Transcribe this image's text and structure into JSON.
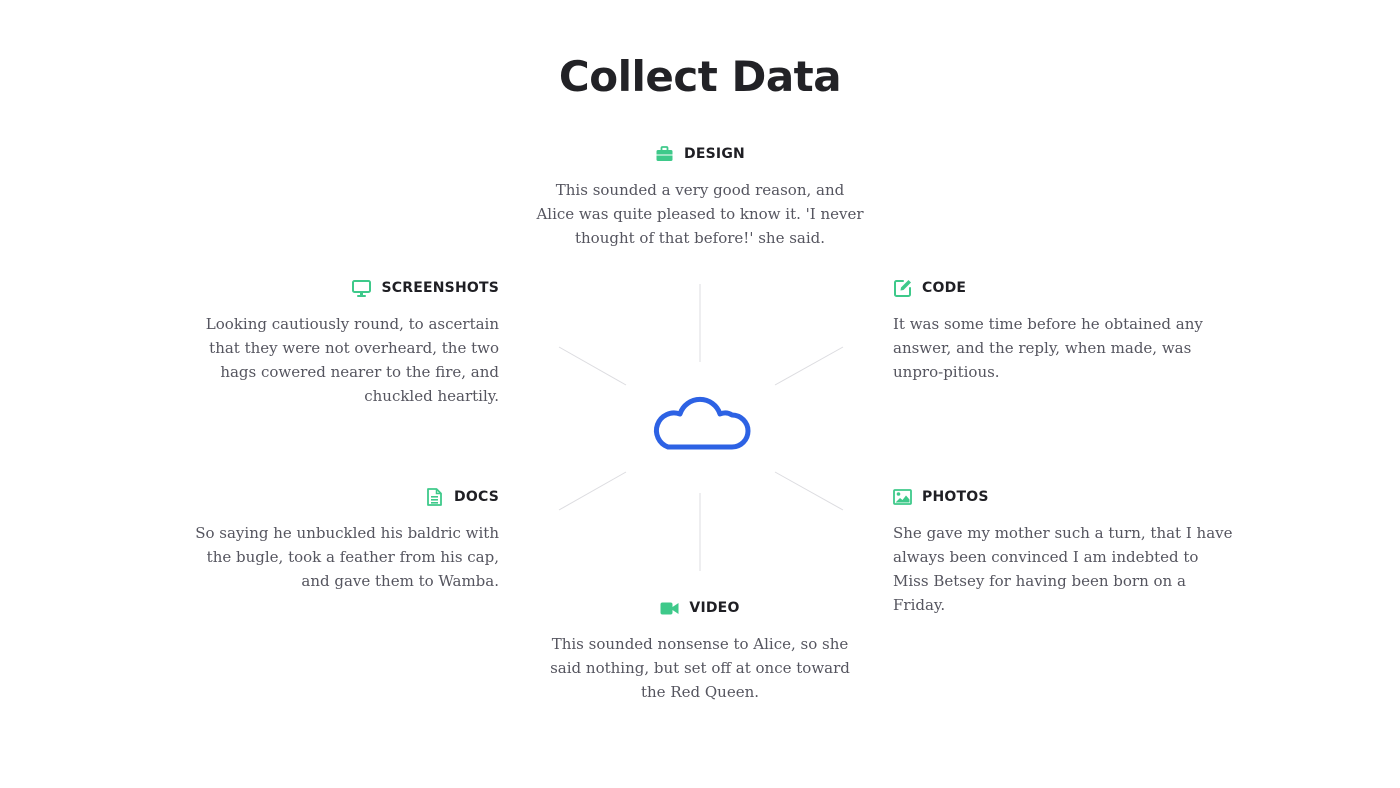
{
  "title": "Collect Data",
  "accent_color": "#3ec98a",
  "cloud_color": "#2d62e4",
  "center_icon": "cloud-icon",
  "features": {
    "design": {
      "label": "DESIGN",
      "icon": "briefcase-icon",
      "text": "This sounded a very good reason, and Alice was quite pleased to know it. 'I never thought of that before!' she said."
    },
    "screenshots": {
      "label": "SCREENSHOTS",
      "icon": "monitor-icon",
      "text": "Looking cautiously round, to ascertain that they were not overheard, the two hags cowered nearer to the fire, and chuckled heartily."
    },
    "code": {
      "label": "CODE",
      "icon": "edit-icon",
      "text": "It was some time before he obtained any answer, and the reply, when made, was unpro-pitious."
    },
    "docs": {
      "label": "DOCS",
      "icon": "document-icon",
      "text": "So saying he unbuckled his baldric with the bugle, took a feather from his cap, and gave them to Wamba."
    },
    "photos": {
      "label": "PHOTOS",
      "icon": "image-icon",
      "text": "She gave my mother such a turn, that I have always been convinced I am indebted to Miss Betsey for having been born on a Friday."
    },
    "video": {
      "label": "VIDEO",
      "icon": "video-camera-icon",
      "text": "This sounded nonsense to Alice, so she said nothing, but set off at once toward the Red Queen."
    }
  }
}
